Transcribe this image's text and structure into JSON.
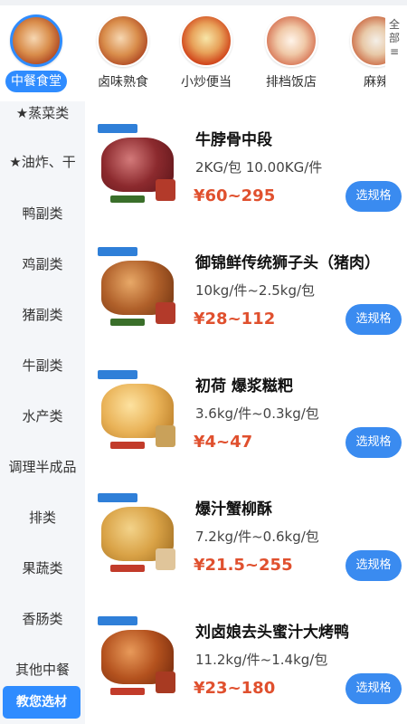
{
  "categories": [
    {
      "label": "中餐食堂",
      "active": true
    },
    {
      "label": "卤味熟食",
      "active": false
    },
    {
      "label": "小炒便当",
      "active": false
    },
    {
      "label": "排档饭店",
      "active": false
    },
    {
      "label": "麻辣",
      "active": false
    }
  ],
  "all_categories_label": "全部",
  "sidebar": {
    "items": [
      "★蒸菜类",
      "★油炸、干",
      "鸭副类",
      "鸡副类",
      "猪副类",
      "牛副类",
      "水产类",
      "调理半成品",
      "排类",
      "果蔬类",
      "香肠类",
      "其他中餐"
    ],
    "cta": "教您选材"
  },
  "products": [
    {
      "title": "牛脖骨中段",
      "spec": "2KG/包 10.00KG/件",
      "price": "¥60~295",
      "button": "选规格"
    },
    {
      "title": "御锦鲜传统狮子头（猪肉）",
      "spec": "10kg/件~2.5kg/包",
      "price": "¥28~112",
      "button": "选规格"
    },
    {
      "title": "初荷 爆浆糍粑",
      "spec": "3.6kg/件~0.3kg/包",
      "price": "¥4~47",
      "button": "选规格"
    },
    {
      "title": "爆汁蟹柳酥",
      "spec": "7.2kg/件~0.6kg/包",
      "price": "¥21.5~255",
      "button": "选规格"
    },
    {
      "title": "刘卤娘去头蜜汁大烤鸭",
      "spec": "11.2kg/件~1.4kg/包",
      "price": "¥23~180",
      "button": "选规格"
    }
  ],
  "colors": {
    "accent": "#2f8cff",
    "price": "#e0502e"
  }
}
